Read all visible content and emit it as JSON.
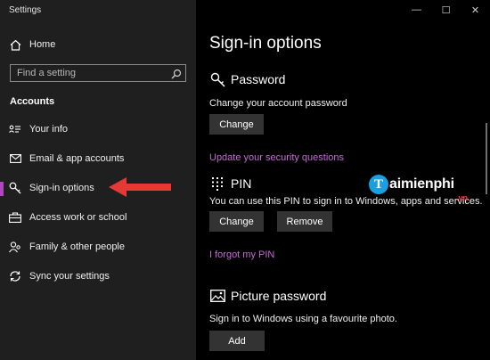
{
  "window": {
    "title": "Settings",
    "controls": {
      "minimize": "—",
      "maximize": "☐",
      "close": "✕"
    }
  },
  "sidebar": {
    "home_label": "Home",
    "search_placeholder": "Find a setting",
    "section_title": "Accounts",
    "items": [
      {
        "label": "Your info",
        "icon": "person-card-icon"
      },
      {
        "label": "Email & app accounts",
        "icon": "mail-icon"
      },
      {
        "label": "Sign-in options",
        "icon": "key-icon",
        "active": true
      },
      {
        "label": "Access work or school",
        "icon": "briefcase-icon"
      },
      {
        "label": "Family & other people",
        "icon": "people-icon"
      },
      {
        "label": "Sync your settings",
        "icon": "sync-icon"
      }
    ],
    "accent_color": "#b146c2",
    "arrow_color": "#e53935"
  },
  "main": {
    "title": "Sign-in options",
    "password": {
      "title": "Password",
      "description": "Change your account password",
      "change_label": "Change",
      "security_link": "Update your security questions"
    },
    "pin": {
      "title": "PIN",
      "description": "You can use this PIN to sign in to Windows, apps and services.",
      "change_label": "Change",
      "remove_label": "Remove",
      "forgot_link": "I forgot my PIN"
    },
    "picture_password": {
      "title": "Picture password",
      "description": "Sign in to Windows using a favourite photo.",
      "add_label": "Add"
    },
    "link_color": "#c56ad6"
  },
  "watermark": {
    "logo_letter": "T",
    "brand": "aimienphi",
    "tld": ".vn"
  }
}
